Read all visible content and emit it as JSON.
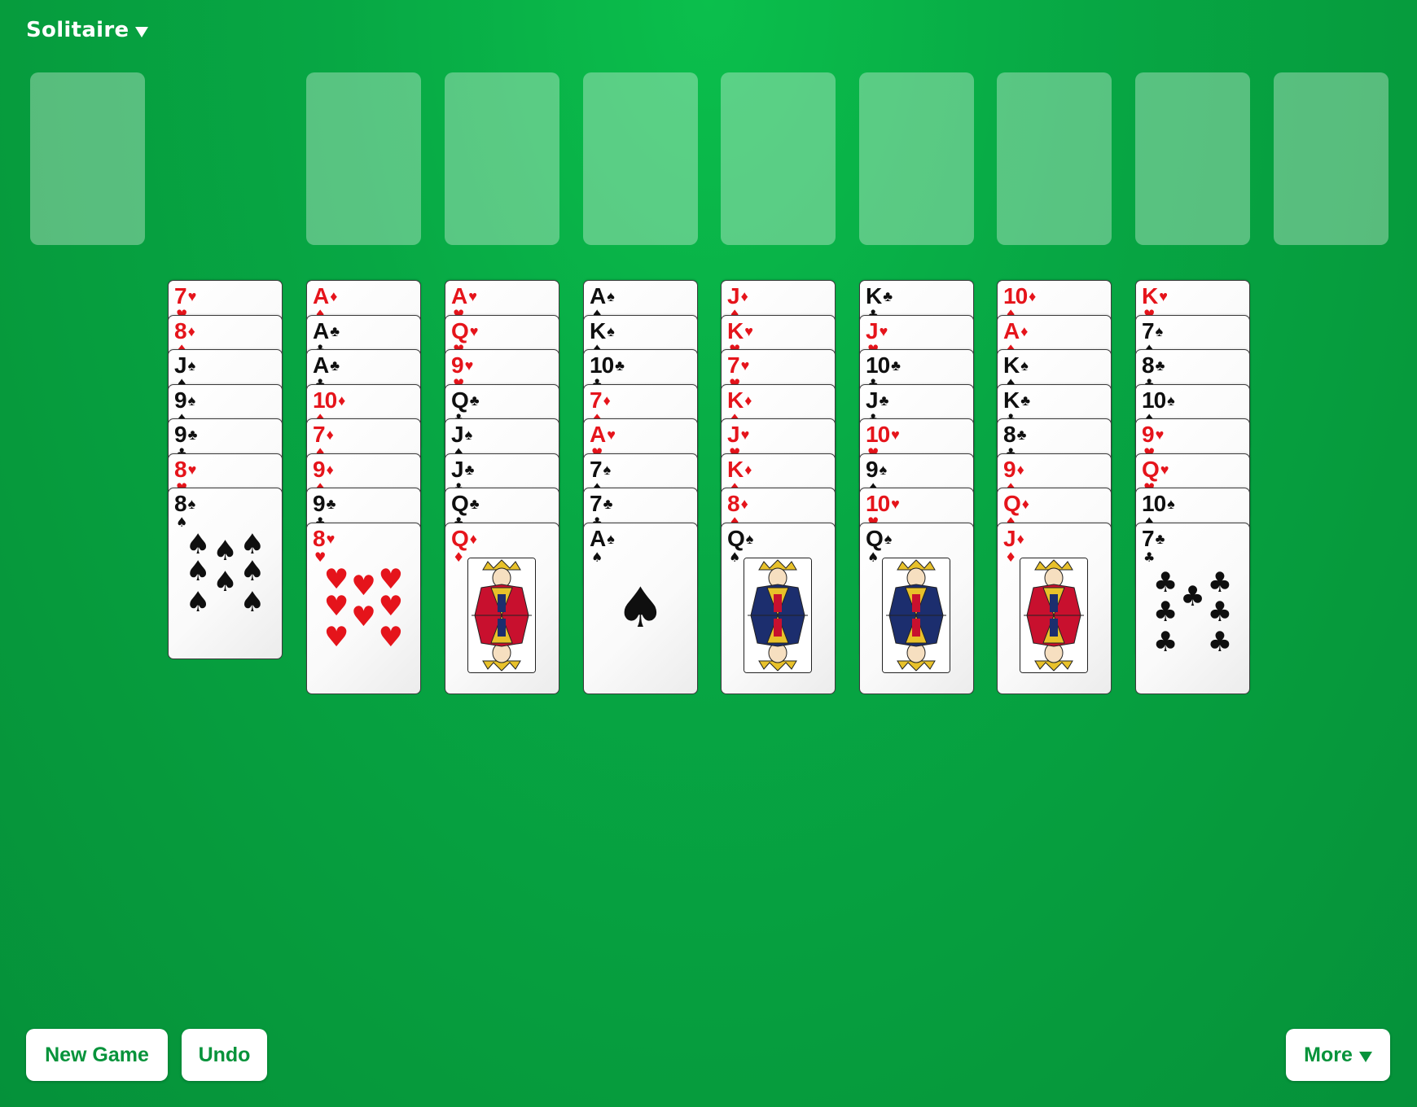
{
  "header": {
    "title": "Solitaire"
  },
  "top_slot_count": 10,
  "tableau": [
    [
      "7♥",
      "8♦",
      "J♠",
      "9♠",
      "9♣",
      "8♥",
      "8♠"
    ],
    [
      "A♦",
      "A♣",
      "A♣",
      "10♦",
      "7♦",
      "9♦",
      "9♣",
      "8♥"
    ],
    [
      "A♥",
      "Q♥",
      "9♥",
      "Q♣",
      "J♠",
      "J♣",
      "Q♣",
      "Q♦"
    ],
    [
      "A♠",
      "K♠",
      "10♣",
      "7♦",
      "A♥",
      "7♠",
      "7♣",
      "A♠"
    ],
    [
      "J♦",
      "K♥",
      "7♥",
      "K♦",
      "J♥",
      "K♦",
      "8♦",
      "Q♠"
    ],
    [
      "K♣",
      "J♥",
      "10♣",
      "J♣",
      "10♥",
      "9♠",
      "10♥",
      "Q♠"
    ],
    [
      "10♦",
      "A♦",
      "K♠",
      "K♣",
      "8♣",
      "9♦",
      "Q♦",
      "J♦"
    ],
    [
      "K♥",
      "7♠",
      "8♣",
      "10♠",
      "9♥",
      "Q♥",
      "10♠",
      "7♣"
    ]
  ],
  "footer": {
    "new_game_label": "New Game",
    "undo_label": "Undo",
    "more_label": "More"
  },
  "colors": {
    "felt": "#07a744",
    "red_suit": "#e5141b",
    "black_suit": "#0f0f0f",
    "button_text": "#07933b"
  }
}
